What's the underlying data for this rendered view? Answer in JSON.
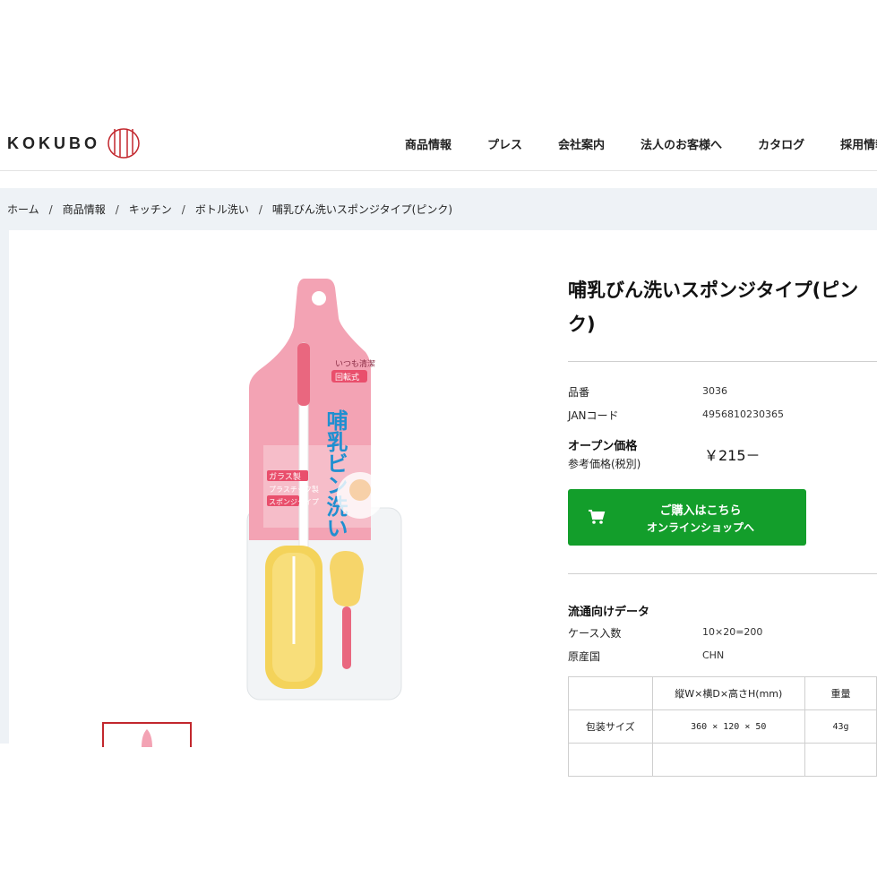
{
  "header": {
    "logo_text": "KOKUBO",
    "nav": [
      "商品情報",
      "プレス",
      "会社案内",
      "法人のお客様へ",
      "カタログ",
      "採用情報"
    ]
  },
  "breadcrumb": [
    "ホーム",
    "商品情報",
    "キッチン",
    "ボトル洗い",
    "哺乳びん洗いスポンジタイプ(ピンク)"
  ],
  "breadcrumb_separator": "/",
  "product": {
    "title": "哺乳びん洗いスポンジタイプ(ピンク)",
    "specs": [
      {
        "label": "品番",
        "value": "3036"
      },
      {
        "label": "JANコード",
        "value": "4956810230365"
      }
    ],
    "open_price": "オープン価格",
    "ref_price_label": "参考価格(税別)",
    "price": "￥215－",
    "buy_button": {
      "line1": "ご購入はこちら",
      "line2": "オンラインショップへ"
    },
    "distribution_title": "流通向けデータ",
    "distribution": [
      {
        "label": "ケース入数",
        "value": "10×20=200"
      },
      {
        "label": "原産国",
        "value": "CHN"
      }
    ],
    "size_table": {
      "headers": [
        "",
        "縦W×横D×高さH(mm)",
        "重量"
      ],
      "rows": [
        [
          "包装サイズ",
          "360 × 120 × 50",
          "43g"
        ]
      ]
    },
    "package_text": {
      "brand": "いつも清潔",
      "badge": "回転式",
      "big": "哺乳ビン洗い",
      "tag1": "ガラス製",
      "tag2": "プラスチック製",
      "tag3": "スポンジタイプ"
    }
  },
  "colors": {
    "accent_green": "#139e2b",
    "logo_red": "#c2272d",
    "band_bg": "#eef2f6",
    "package_pink": "#f0879f"
  }
}
